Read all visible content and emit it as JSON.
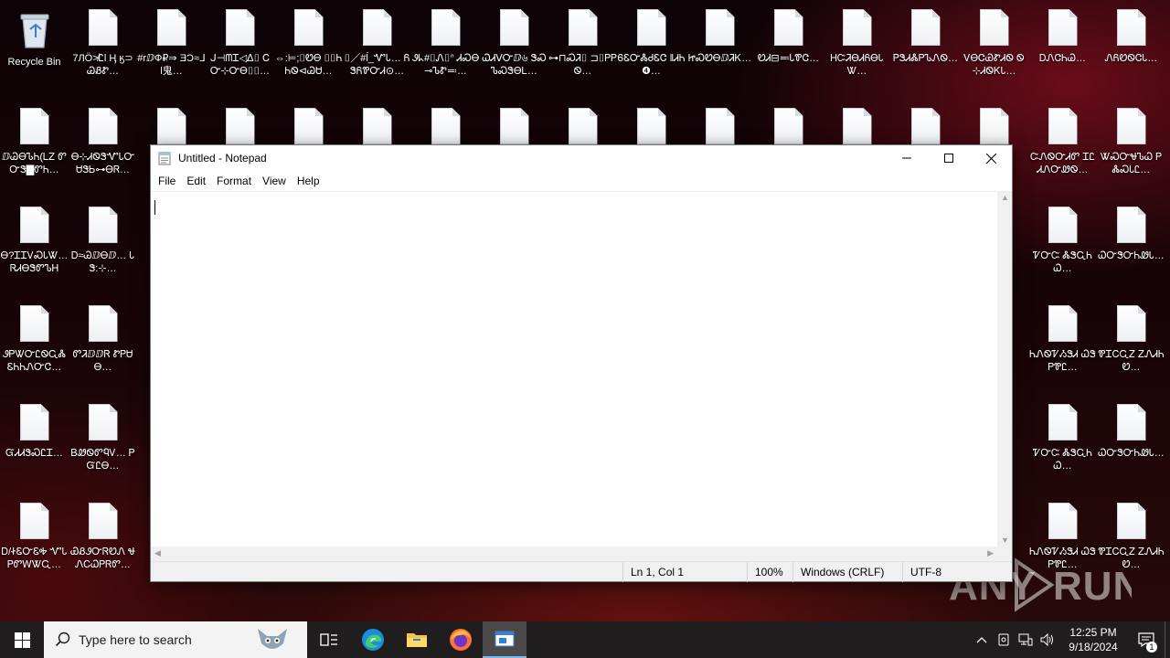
{
  "desktop": {
    "recycle_bin_label": "Recycle Bin",
    "icons": [
      {
        "label": "7ЛÖ≯Ꮭl Ӊ ӄ⊃ᏊᏰᏑ…"
      },
      {
        "label": "#rⅅФ₽⇒ ƎϽ≈ᒧl鬼…"
      },
      {
        "label": "ᒍ⊣ᗰᏆ◁ᐃ⌷ ᏟᏅ⊹ᏅᎾ⌷⌷…"
      },
      {
        "label": "⇔:⊨;⌷ᏬᎾ ⌷⌷ᏂᏂᏫ⊲ᏊᏌ…"
      },
      {
        "label": "⌷／#ĺ_ᏉᏓ… ᏲᏕᏲᏈᏅᏗ⊙…"
      },
      {
        "label": "Ꮽᖾ#⌷Ꮑ⌷ᐢ ᏗᏍᎾ⊸ᏖᏑ≕…"
      },
      {
        "label": "ᏇᏗᐻᏅⅅ৬ ᏕᏍᏖᏍᏕᎾᏞ…"
      },
      {
        "label": "⊶⊓ᏍᏘ⌷ ⊐⌷ᏢᏢᏫ…"
      },
      {
        "label": "ᏮᏋᏅᏜᏧᏋᏣ ǁᏗᏂ❹…"
      },
      {
        "label": "ᏥᏍᏬᎾⅅᏘᏦ…"
      },
      {
        "label": "ᏬᏗ⊟≕ᏓᏈᏣ…"
      },
      {
        "label": "ᎻᏨᏘᎾᏗᏲᎾᏓᏔ…"
      },
      {
        "label": "ᏢᏕᏗᏜᏢᏖᏁᏫ…"
      },
      {
        "label": "ᏙᎾᏣᏯᏑᏗᏫ Ꮻ⊹ᏗᏫᏦᏓ…"
      },
      {
        "label": "ᎠᏁᏣᏂᏊ…"
      },
      {
        "label": "ᏁᏲᏬᏫᏣᏓ…"
      },
      {
        "label": "ⅅᏊᎾᏖᏂ(ᏞᏃ ᏛᏅᏕ▇ᏛᏂ…"
      },
      {
        "label": "Ꮎ⊹ᏗᏫᏕᏉᏓᏅ ᏌᏕᏏ⊶ᎾᏒ…"
      },
      {
        "label": "Ꮎ?ᏆᏆᏙᏍᏓᏔ… ᏒᏗᎾᏕᏛᏖᎻ"
      },
      {
        "label": "Ꭰ≈ᏊⅅᎾⅅ… ᏓᏕ:⊹…"
      },
      {
        "label": "ᏭᏢᏔᏅᏝᏫᏩᏜ ᏋᏂᏂᏁᏅᏣ…"
      },
      {
        "label": "ᏛᏘⅅⅅᏒ ᏑᏢᏌᎾ…"
      },
      {
        "label": "ᏳᏗᏗᏕᏍᏝᏆ…"
      },
      {
        "label": "ᏴᏪᏫᏛᏄᏙ… ᏢᏳᏝᎾ…"
      },
      {
        "label": "Ꭰ/ᏐᏋᏅᏋᎭ ᏉᏓᏢᏛᎳᏔᏩ…"
      },
      {
        "label": "ᏯᏰᏭᏅᏒᏬᏁ ᏠᏁᏟᏇᏢᏒᏛ…"
      },
      {
        "label": "ᏤᏅᏨ ᏜᏕᏩᏂᏇ…"
      },
      {
        "label": "ᏇᏅᏕᏅᏂᏪᏓ…"
      },
      {
        "label": "ᏨᏁᏫᏅᏗᏛ ᏆᏝᏗᏁᏅᏪᏫ…"
      },
      {
        "label": "ᏔᏍᏅᏠᏖᏇ ᏢᏜᏍᏓᏝ…"
      },
      {
        "label": "ᏂᏁᏫᏤᏱᏕᏗ ᏇᏕᏢᏈᏝ…"
      },
      {
        "label": "ᏈᏆᏟᏩᏃ ᏃᏁᏗᏂᏬ…"
      }
    ]
  },
  "notepad": {
    "title": "Untitled - Notepad",
    "menu": [
      "File",
      "Edit",
      "Format",
      "View",
      "Help"
    ],
    "content": "",
    "status": {
      "position": "Ln 1, Col 1",
      "zoom": "100%",
      "line_ending": "Windows (CRLF)",
      "encoding": "UTF-8"
    }
  },
  "taskbar": {
    "search_placeholder": "Type here to search",
    "clock_time": "12:25 PM",
    "clock_date": "9/18/2024",
    "notification_count": "1"
  },
  "watermark": "ANY RUN",
  "colors": {
    "accent": "#76b9ed",
    "taskbar": "#201d1f",
    "window_bg": "#ffffff"
  }
}
